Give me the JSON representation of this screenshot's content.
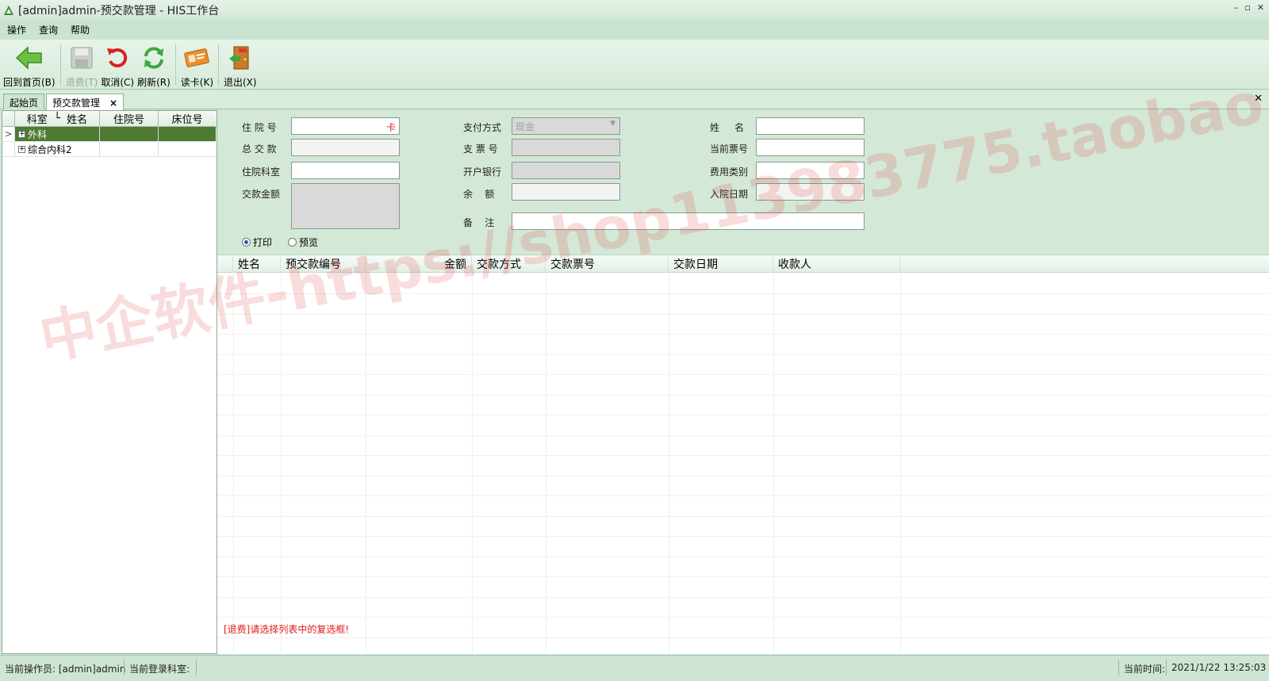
{
  "window": {
    "title": "[admin]admin-预交款管理 - HIS工作台",
    "controls": [
      "–",
      "▫",
      "✕"
    ]
  },
  "menu": [
    "操作",
    "查询",
    "帮助"
  ],
  "toolbar": {
    "home": "回到首页(B)",
    "refund": "退费(T)",
    "cancel": "取消(C)",
    "refresh": "刷新(R)",
    "read_card": "读卡(K)",
    "exit": "退出(X)"
  },
  "tabs": {
    "start": "起始页",
    "current": "预交款管理",
    "close": "×"
  },
  "tree": {
    "columns": [
      "科室",
      "姓名",
      "住院号",
      "床位号"
    ],
    "rows": [
      {
        "marker": ">",
        "expander": "+",
        "dept": "外科",
        "selected": true
      },
      {
        "marker": "",
        "expander": "+",
        "dept": "综合内科2",
        "selected": false
      }
    ]
  },
  "form": {
    "admission_no_label": "住 院 号",
    "admission_no_marker": "卡",
    "total_paid_label": "总 交 款",
    "ward_label": "住院科室",
    "pay_amount_label": "交款金额",
    "pay_method_label": "支付方式",
    "pay_method_value": "现金",
    "cheque_no_label": "支 票 号",
    "bank_label": "开户银行",
    "balance_label": "余    额",
    "remark_label": "备    注",
    "name_label": "姓     名",
    "receipt_no_label": "当前票号",
    "fee_type_label": "费用类别",
    "admit_date_label": "入院日期",
    "print_label": "打印",
    "preview_label": "预览",
    "print_selected": true
  },
  "grid": {
    "columns": [
      "姓名",
      "预交款编号",
      "金额",
      "交款方式",
      "交款票号",
      "交款日期",
      "收款人"
    ],
    "warning": "[退费]请选择列表中的复选框!"
  },
  "status": {
    "operator": "当前操作员: [admin]admin",
    "login_dept": "当前登录科室:",
    "time_label": "当前时间:",
    "time_value": "2021/1/22 13:25:03"
  },
  "watermark": "中企软件-https://shop113983775.taobao.com"
}
